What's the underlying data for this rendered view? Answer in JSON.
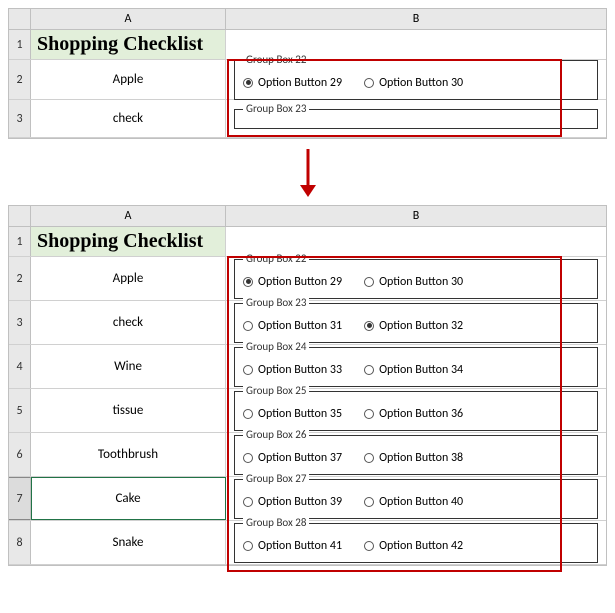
{
  "col_A": "A",
  "col_B": "B",
  "title": "Shopping Checklist",
  "sheet1": {
    "rows": [
      "1",
      "2",
      "3"
    ],
    "items": [
      "Apple",
      "check"
    ],
    "gb1": {
      "label": "Group Box 22",
      "o1": "Option Button 29",
      "o2": "Option Button 30",
      "sel": 1
    },
    "gb2": {
      "label": "Group Box 23"
    }
  },
  "sheet2": {
    "rows": [
      "1",
      "2",
      "3",
      "4",
      "5",
      "6",
      "7",
      "8"
    ],
    "items": [
      "Apple",
      "check",
      "Wine",
      "tissue",
      "Toothbrush",
      "Cake",
      "Snake"
    ],
    "groups": [
      {
        "label": "Group Box 22",
        "o1": "Option Button 29",
        "o2": "Option Button 30",
        "sel": 1
      },
      {
        "label": "Group Box 23",
        "o1": "Option Button 31",
        "o2": "Option Button 32",
        "sel": 2
      },
      {
        "label": "Group Box 24",
        "o1": "Option Button 33",
        "o2": "Option Button 34",
        "sel": 0
      },
      {
        "label": "Group Box 25",
        "o1": "Option Button 35",
        "o2": "Option Button 36",
        "sel": 0
      },
      {
        "label": "Group Box 26",
        "o1": "Option Button 37",
        "o2": "Option Button 38",
        "sel": 0
      },
      {
        "label": "Group Box 27",
        "o1": "Option Button 39",
        "o2": "Option Button 40",
        "sel": 0
      },
      {
        "label": "Group Box 28",
        "o1": "Option Button 41",
        "o2": "Option Button 42",
        "sel": 0
      }
    ]
  }
}
